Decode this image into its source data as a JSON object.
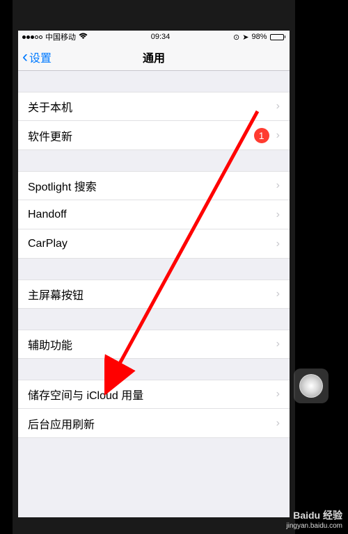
{
  "status_bar": {
    "carrier": "中国移动",
    "time": "09:34",
    "battery_pct": "98%"
  },
  "nav": {
    "back_label": "设置",
    "title": "通用"
  },
  "groups": [
    {
      "items": [
        {
          "label": "关于本机",
          "badge": null
        },
        {
          "label": "软件更新",
          "badge": "1"
        }
      ]
    },
    {
      "items": [
        {
          "label": "Spotlight 搜索",
          "badge": null
        },
        {
          "label": "Handoff",
          "badge": null
        },
        {
          "label": "CarPlay",
          "badge": null
        }
      ]
    },
    {
      "items": [
        {
          "label": "主屏幕按钮",
          "badge": null
        }
      ]
    },
    {
      "items": [
        {
          "label": "辅助功能",
          "badge": null
        }
      ]
    },
    {
      "items": [
        {
          "label": "储存空间与 iCloud 用量",
          "badge": null
        },
        {
          "label": "后台应用刷新",
          "badge": null
        }
      ]
    }
  ],
  "annotation": {
    "arrow_color": "#ff0000"
  },
  "watermark": {
    "brand": "Baidu 经验",
    "sub": "jingyan.baidu.com"
  }
}
